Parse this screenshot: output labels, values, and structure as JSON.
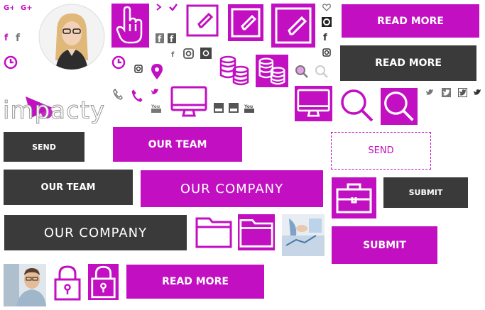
{
  "logo": {
    "text": "impacty"
  },
  "buttons": {
    "read_more_1": "READ MORE",
    "read_more_2": "READ MORE",
    "read_more_3": "READ MORE",
    "send_dark": "SEND",
    "send_outline": "SEND",
    "our_team_mag": "OUR TEAM",
    "our_team_dark": "OUR TEAM",
    "our_company_mag": "OUR COMPANY",
    "our_company_dark": "OUR COMPANY",
    "submit_dark": "SUBMIT",
    "submit_mag": "SUBMIT"
  },
  "colors": {
    "accent": "#c20fc2",
    "dark": "#3a3a3a",
    "grey": "#777777"
  },
  "icons": [
    "google-plus-icon",
    "facebook-icon",
    "clock-icon",
    "hand-pointer-icon",
    "chevron-right-icon",
    "check-icon",
    "heart-icon",
    "edit-icon",
    "instagram-icon",
    "map-marker-icon",
    "coins-icon",
    "search-icon",
    "phone-icon",
    "twitter-icon",
    "youtube-icon",
    "monitor-icon",
    "briefcase-icon",
    "folder-icon",
    "lock-icon"
  ]
}
